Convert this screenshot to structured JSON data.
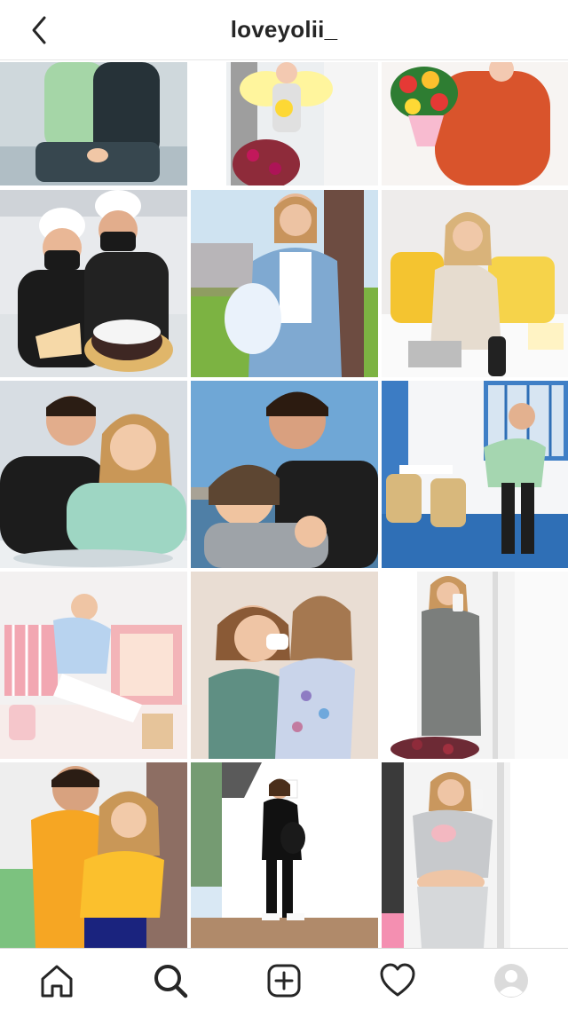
{
  "header": {
    "back_icon": "chevron-left-icon",
    "username": "loveyolii_"
  },
  "grid": {
    "posts": [
      {
        "scene": "couple-city-bench",
        "multi": false
      },
      {
        "scene": "girl-fairy-costume-flowers",
        "multi": false
      },
      {
        "scene": "woman-orange-sweater-bouquet",
        "multi": false
      },
      {
        "scene": "chefs-with-cake",
        "multi": false
      },
      {
        "scene": "pregnant-woman-denim-jacket-tree",
        "multi": false
      },
      {
        "scene": "woman-bed-yellow-pillows",
        "multi": false
      },
      {
        "scene": "couple-selfie-mint-sweater",
        "multi": false
      },
      {
        "scene": "man-kissing-woman-forehead",
        "multi": false
      },
      {
        "scene": "woman-cafe-terrace",
        "multi": false
      },
      {
        "scene": "woman-pink-decor-floor",
        "multi": false
      },
      {
        "scene": "mother-daughter-beach",
        "multi": false
      },
      {
        "scene": "pregnant-woman-mirror-selfie-grey",
        "multi": false
      },
      {
        "scene": "couple-yellow-hoodies",
        "multi": false
      },
      {
        "scene": "pregnant-woman-black-outfit-wall",
        "multi": true
      },
      {
        "scene": "pregnant-woman-grey-sweatsuit-selfie",
        "multi": false
      }
    ]
  },
  "bottom_nav": {
    "items": [
      {
        "icon": "home-icon"
      },
      {
        "icon": "search-icon",
        "active": true
      },
      {
        "icon": "plus-square-icon"
      },
      {
        "icon": "heart-icon"
      },
      {
        "icon": "profile-avatar-icon"
      }
    ]
  },
  "colors": {
    "text": "#262626",
    "border": "#dbdbdb",
    "background": "#ffffff"
  }
}
